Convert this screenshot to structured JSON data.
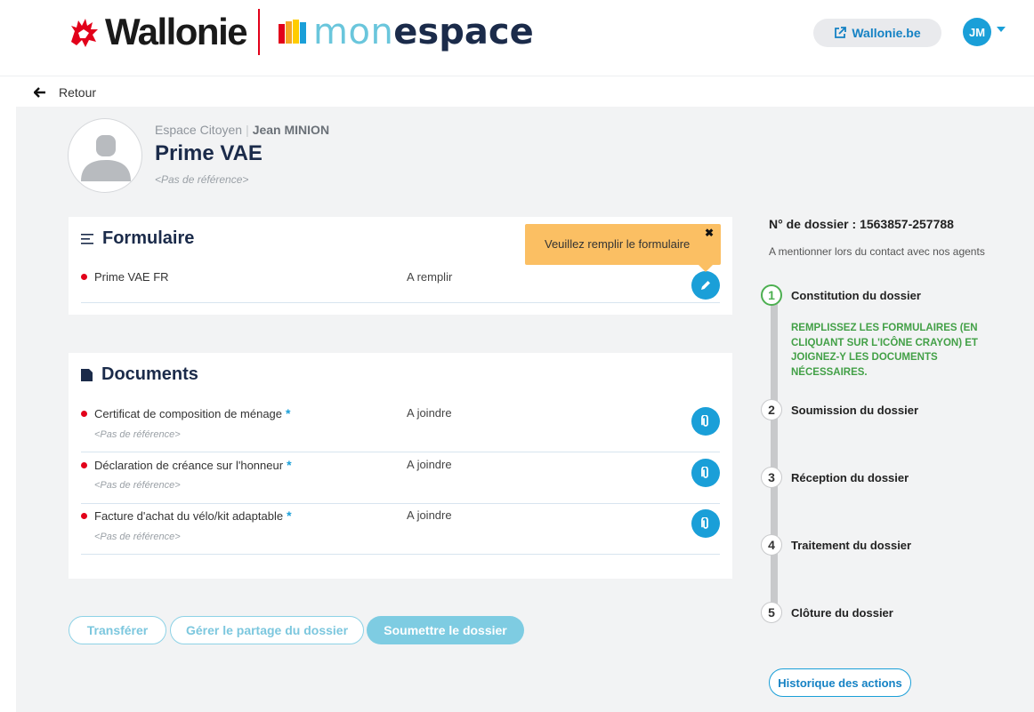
{
  "header": {
    "logo_wallonie": "Wallonie",
    "logo_mon": "mon",
    "logo_espace": "espace",
    "wallonie_link": "Wallonie.be",
    "user_initials": "JM"
  },
  "nav": {
    "back_label": "Retour"
  },
  "profile": {
    "space": "Espace Citoyen",
    "user_name": "Jean MINION",
    "title": "Prime VAE",
    "reference": "<Pas de référence>"
  },
  "formulaire": {
    "title": "Formulaire",
    "tooltip": "Veuillez remplir le formulaire",
    "rows": [
      {
        "label": "Prime VAE FR",
        "status": "A remplir"
      }
    ]
  },
  "documents": {
    "title": "Documents",
    "rows": [
      {
        "label": "Certificat de composition de ménage",
        "required": "*",
        "reference": "<Pas de référence>",
        "status": "A joindre"
      },
      {
        "label": "Déclaration de créance sur l'honneur",
        "required": "*",
        "reference": "<Pas de référence>",
        "status": "A joindre"
      },
      {
        "label": "Facture d'achat du vélo/kit adaptable",
        "required": "*",
        "reference": "<Pas de référence>",
        "status": "A joindre"
      }
    ]
  },
  "actions": {
    "transfer": "Transférer",
    "share": "Gérer le partage du dossier",
    "submit": "Soumettre le dossier"
  },
  "dossier": {
    "number_label": "N° de dossier : 1563857-257788",
    "note": "A mentionner lors du contact avec nos agents",
    "steps": [
      {
        "num": "1",
        "label": "Constitution du dossier",
        "desc": "REMPLISSEZ LES FORMULAIRES (EN CLIQUANT SUR L'ICÔNE CRAYON) ET JOIGNEZ-Y LES DOCUMENTS NÉCESSAIRES."
      },
      {
        "num": "2",
        "label": "Soumission du dossier"
      },
      {
        "num": "3",
        "label": "Réception du dossier"
      },
      {
        "num": "4",
        "label": "Traitement du dossier"
      },
      {
        "num": "5",
        "label": "Clôture du dossier"
      }
    ],
    "history_button": "Historique des actions"
  },
  "colors": {
    "accent": "#1a9fd8",
    "title": "#1b2b4a",
    "status_dot": "#e2001a",
    "active_step": "#4caf50",
    "tooltip": "#fbbf63"
  },
  "icons": {
    "wallonie_logo": "rooster-icon",
    "external_link": "external-link-icon",
    "back": "arrow-left-icon",
    "user_placeholder": "user-silhouette-icon",
    "formulaire": "list-lines-icon",
    "documents": "document-icon",
    "edit": "pencil-icon",
    "attach": "paperclip-icon",
    "close": "close-icon"
  }
}
